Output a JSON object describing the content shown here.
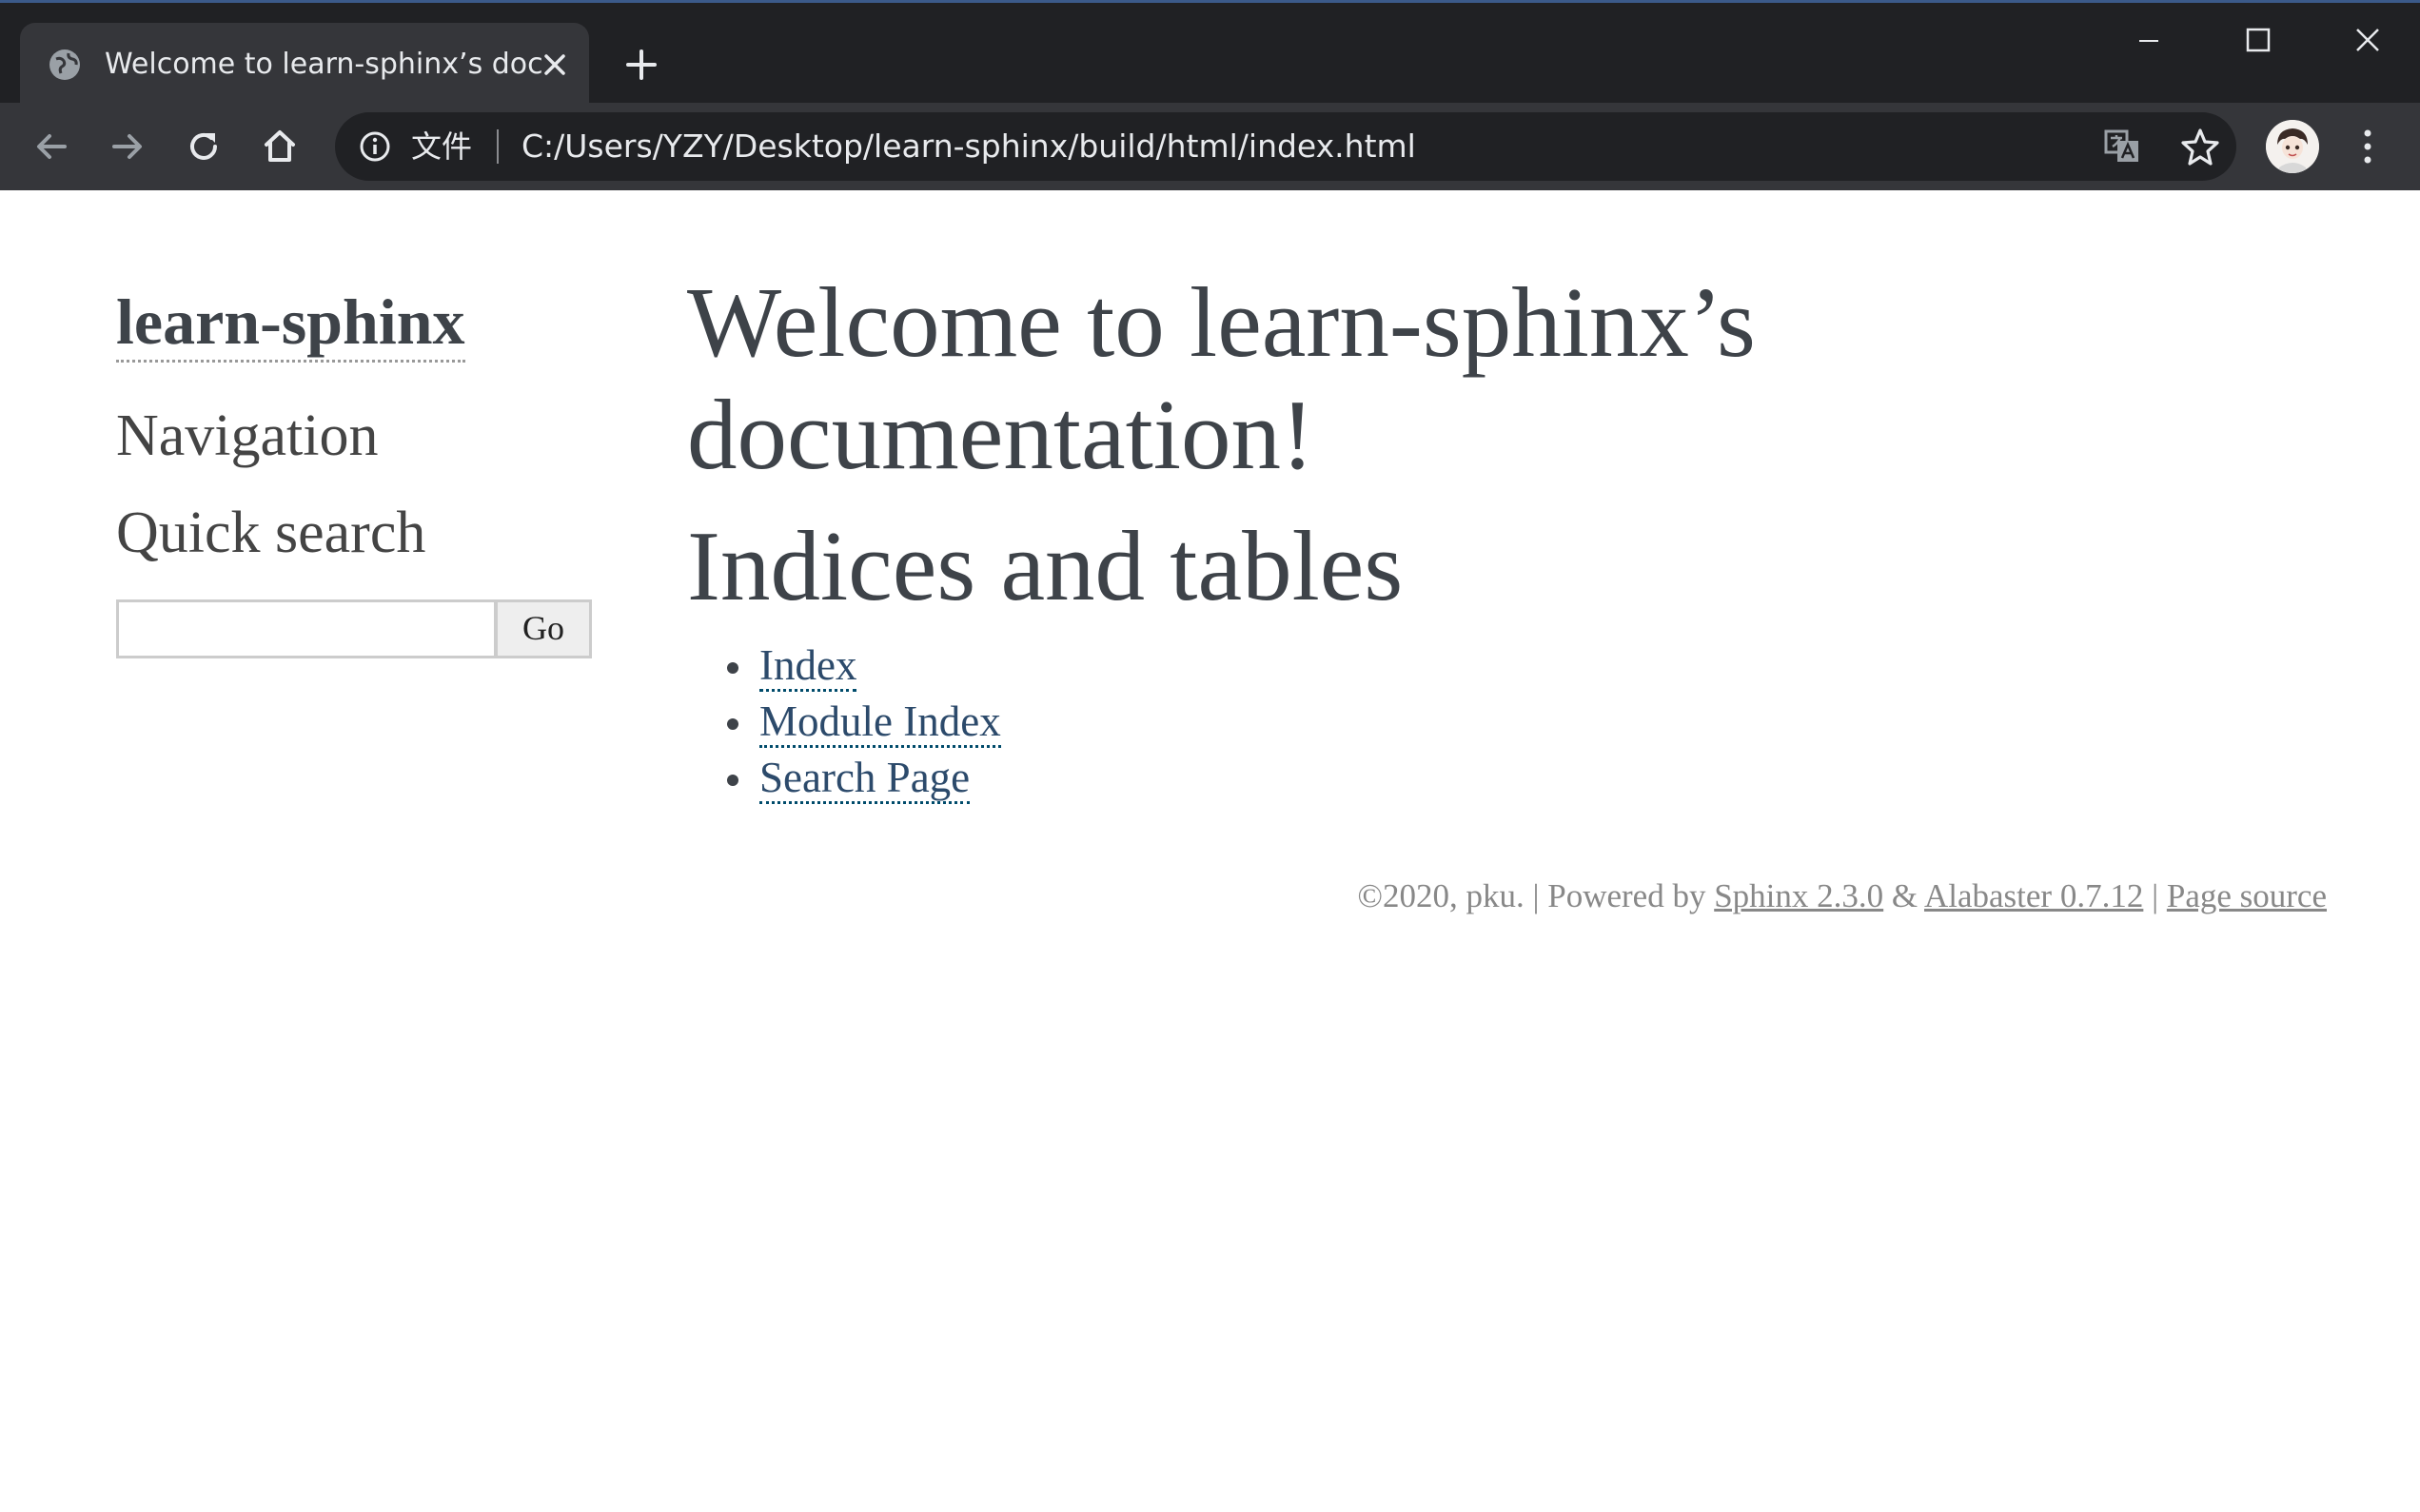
{
  "browser": {
    "tab": {
      "title": "Welcome to learn-sphinx’s documentation!"
    },
    "omnibox": {
      "scheme_label": "文件",
      "url": "C:/Users/YZY/Desktop/learn-sphinx/build/html/index.html"
    },
    "icons": {
      "favicon": "globe-icon",
      "tab_close": "close-icon",
      "new_tab": "plus-icon",
      "back": "arrow-left-icon",
      "forward": "arrow-right-icon",
      "reload": "reload-icon",
      "home": "home-icon",
      "info": "info-icon",
      "translate": "translate-icon",
      "bookmark": "star-icon",
      "menu": "more-vertical-icon"
    },
    "colors": {
      "tabbar_bg": "#202124",
      "toolbar_bg": "#35363a",
      "omnibox_bg": "#202124",
      "chrome_text": "#e8eaed"
    }
  },
  "sidebar": {
    "logo": "learn-sphinx",
    "navigation_heading": "Navigation",
    "quick_search_heading": "Quick search",
    "search": {
      "value": "",
      "button": "Go"
    }
  },
  "main": {
    "title": "Welcome to learn-sphinx’s documentation!",
    "section_heading": "Indices and tables",
    "links": [
      {
        "label": "Index"
      },
      {
        "label": "Module Index"
      },
      {
        "label": "Search Page"
      }
    ]
  },
  "footer": {
    "copyright": "©2020, pku.",
    "sep1": "|",
    "powered_by": "Powered by",
    "sphinx_link": "Sphinx 2.3.0",
    "amp": "&",
    "alabaster_link": "Alabaster 0.7.12",
    "sep2": "|",
    "page_source": "Page source"
  },
  "page_colors": {
    "text": "#3e4349",
    "link": "#2c4a6b",
    "footer_text": "#888888"
  }
}
